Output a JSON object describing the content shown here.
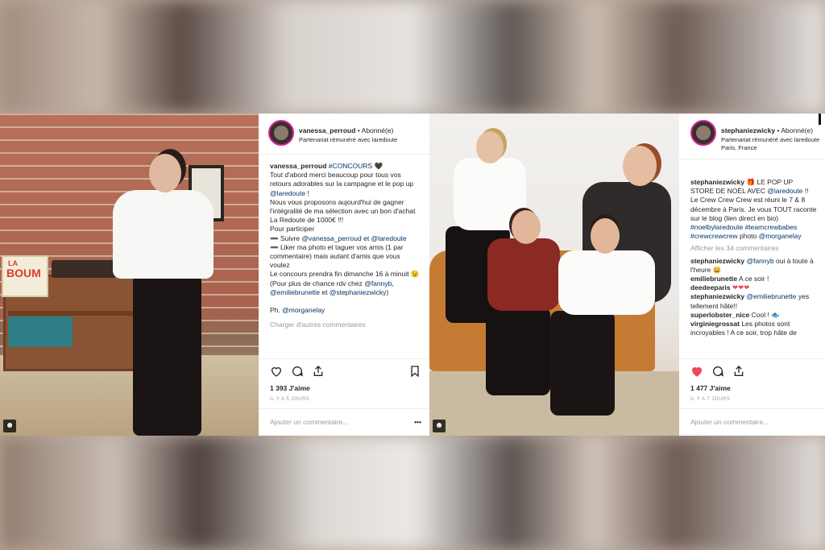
{
  "post1": {
    "username": "vanessa_perroud",
    "follow_status": "• Abonné(e)",
    "partnership": "Partenariat rémunéré avec laredoute",
    "caption_user": "vanessa_perroud",
    "caption_hashtag": "#CONCOURS",
    "caption_heart": "🖤",
    "caption_p1": "Tout d'abord merci beaucoup pour tous vos retours adorables sur la campagne et le pop up ",
    "caption_mention1": "@laredoute",
    "caption_p1b": " !",
    "caption_p2": "Nous vous proposons aujourd'hui de gagner l'intégralité de ma sélection avec un bon d'achat La Redoute de 1000€ !!!",
    "caption_p3": "Pour participer",
    "caption_p4": "➖ Suivre ",
    "caption_mention2": "@vanessa_perroud",
    "caption_p4b": " et ",
    "caption_mention3": "@laredoute",
    "caption_p5": "➖ Liker ma photo et taguer vos amis (1 par commentaire) mais autant d'amis que vous voulez",
    "caption_p6": "Le concours prendra fin dimanche 16 à minuit 😉 (Pour plus de chance rdv chez ",
    "caption_mention4": "@fannyb",
    "caption_p6b": ", ",
    "caption_mention5": "@emiliebrunette",
    "caption_p6c": " et ",
    "caption_mention6": "@stephaniezwicky",
    "caption_p6d": ")",
    "credit_prefix": "Ph. ",
    "credit_mention": "@morganelay",
    "load_more": "Charger d'autres commentaires",
    "likes": "1 393 J'aime",
    "date": "IL Y A 5 JOURS",
    "add_comment": "Ajouter un commentaire...",
    "options": "•••"
  },
  "post2": {
    "username": "stephaniezwicky",
    "follow_status": "• Abonné(e)",
    "partnership": "Partenariat rémunéré avec laredoute",
    "location": "Paris, France",
    "caption_user": "stephaniezwicky",
    "caption_icon": "🎁",
    "caption_text1": " LE POP UP STORE DE NOËL AVEC ",
    "caption_mention1": "@laredoute",
    "caption_text2": " !! Le Crew Crew Crew est réuni le 7 & 8 décembre à Paris. Je vous TOUT raconte sur le blog (lien direct en bio) ",
    "caption_tags": "#noelbylaredoute #teamcrewbabes #crewcrewcrew",
    "caption_text3": " photo ",
    "caption_mention2": "@morganelay",
    "view_comments": "Afficher les 34 commentaires",
    "comments": [
      {
        "user": "stephaniezwicky",
        "pre": " ",
        "mention": "@fannyb",
        "text": " oui à toute à l'heure 😄"
      },
      {
        "user": "emiliebrunette",
        "pre": " ",
        "mention": "",
        "text": "A ce soir !"
      },
      {
        "user": "deedeeparis",
        "pre": " ",
        "mention": "",
        "text": "❤❤❤"
      },
      {
        "user": "stephaniezwicky",
        "pre": " ",
        "mention": "@emiliebrunette",
        "text": " yes tellement hâte!!"
      },
      {
        "user": "superlobster_nice",
        "pre": " ",
        "mention": "",
        "text": "Cool ! 🐟"
      },
      {
        "user": "virginiegrossat",
        "pre": " ",
        "mention": "",
        "text": "Les photos sont incroyables ! A ce soir, trop hâte de"
      }
    ],
    "likes": "1 477 J'aime",
    "date": "IL Y A 7 JOURS",
    "add_comment": "Ajouter un commentaire..."
  },
  "photo1_text": {
    "poster_top": "LA",
    "poster_main": "BOUM"
  },
  "colors": {
    "liked_heart": "#ed4956",
    "link": "#003569",
    "story_ring": "#d6249f"
  },
  "icons": [
    "heart-icon",
    "comment-icon",
    "share-icon",
    "bookmark-icon",
    "user-tag-icon"
  ]
}
